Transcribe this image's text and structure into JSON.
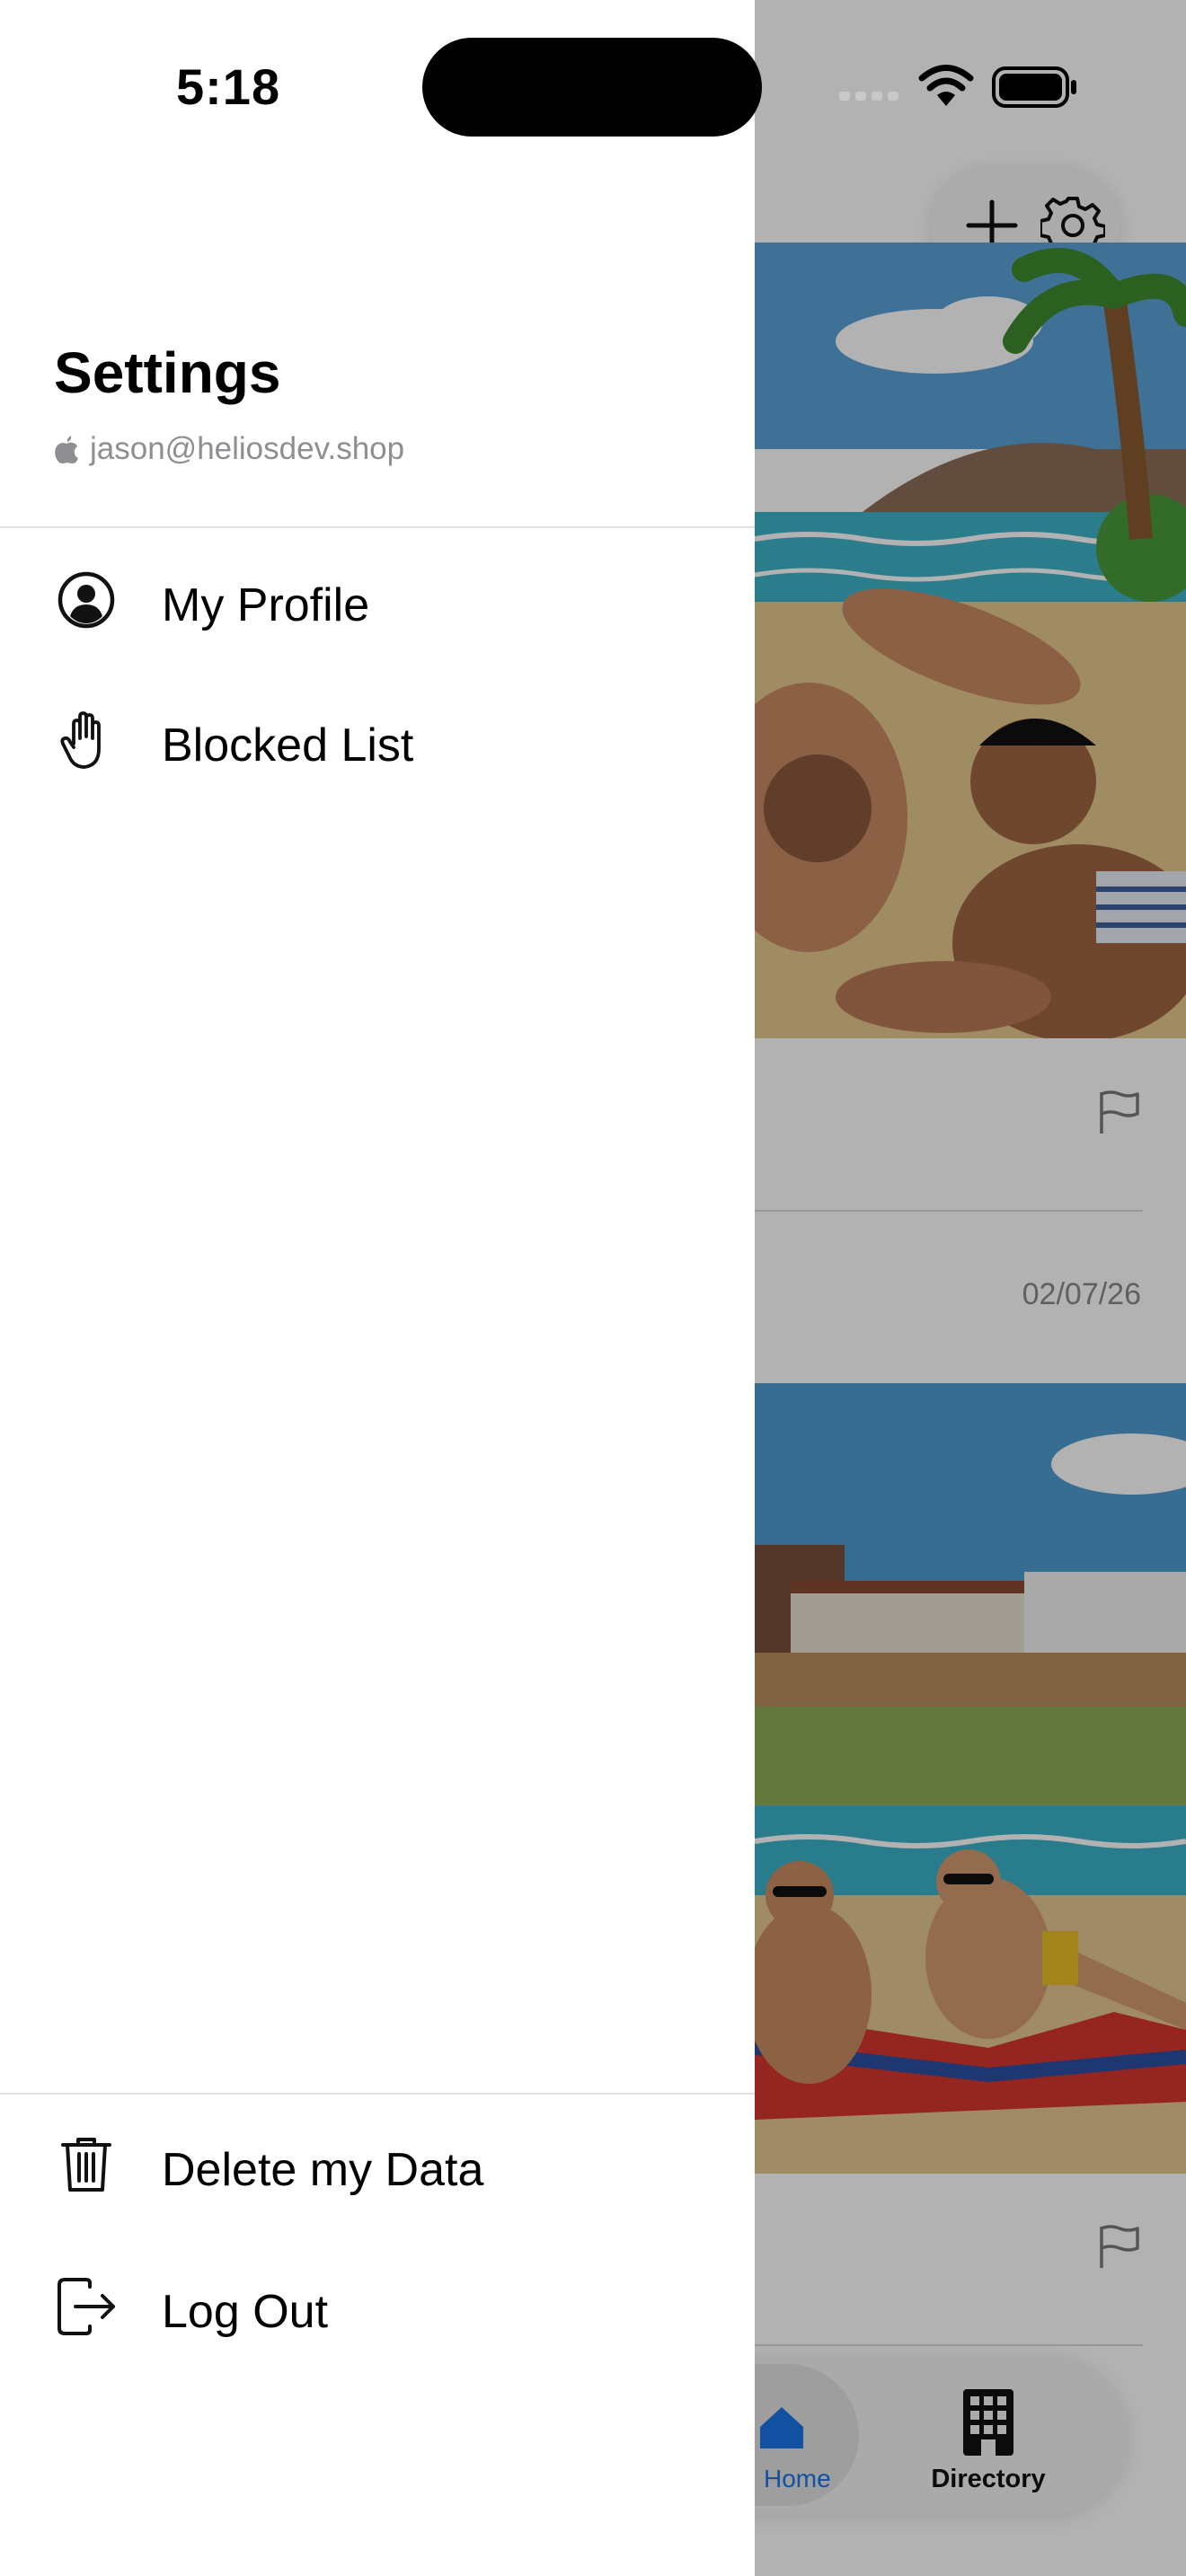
{
  "status_bar": {
    "time": "5:18"
  },
  "drawer": {
    "title": "Settings",
    "account_email": "jason@heliosdev.shop",
    "menu": [
      {
        "label": "My Profile",
        "icon": "person-circle-icon"
      },
      {
        "label": "Blocked List",
        "icon": "hand-raised-icon"
      }
    ],
    "footer_menu": [
      {
        "label": "Delete my Data",
        "icon": "trash-icon"
      },
      {
        "label": "Log Out",
        "icon": "logout-icon"
      }
    ]
  },
  "feed": {
    "post_date": "02/07/26",
    "images": [
      "beach cartoon: men lounging on sand under palm tree",
      "beach cartoon: men on towels in front of beach houses"
    ]
  },
  "tab_bar": {
    "tabs": [
      {
        "label": "Home",
        "icon": "house-icon",
        "active": true
      },
      {
        "label": "Directory",
        "icon": "building-icon",
        "active": false
      }
    ]
  },
  "colors": {
    "accent": "#1a73e8",
    "drawer_bg": "#ffffff",
    "scrim": "rgba(0,0,0,0.30)"
  }
}
